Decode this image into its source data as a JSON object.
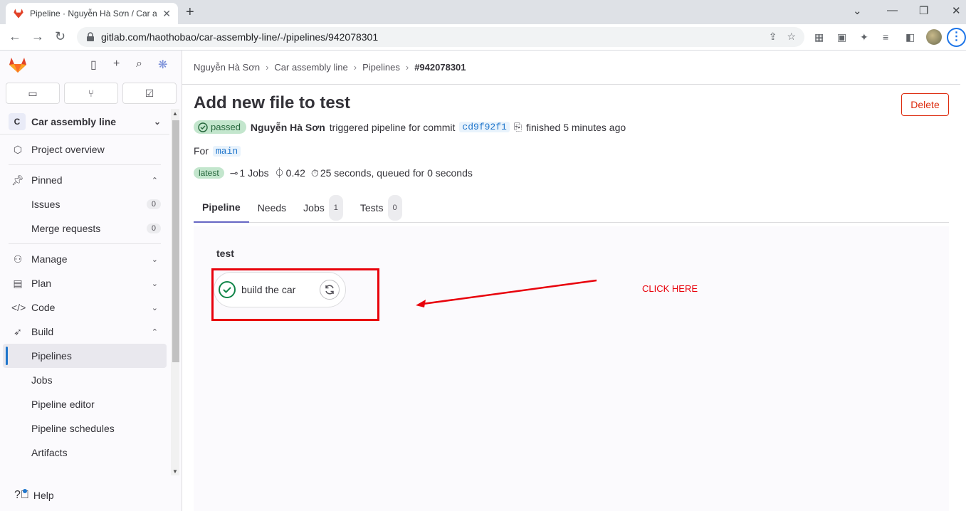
{
  "browser": {
    "tab_title": "Pipeline · Nguyễn Hà Sơn / Car a",
    "url": "gitlab.com/haothobao/car-assembly-line/-/pipelines/942078301"
  },
  "sidebar": {
    "project_initial": "C",
    "project_name": "Car assembly line",
    "items": {
      "project_overview": "Project overview",
      "pinned": "Pinned",
      "issues": "Issues",
      "issues_count": "0",
      "merge_requests": "Merge requests",
      "merge_requests_count": "0",
      "manage": "Manage",
      "plan": "Plan",
      "code": "Code",
      "build": "Build",
      "pipelines": "Pipelines",
      "jobs": "Jobs",
      "pipeline_editor": "Pipeline editor",
      "pipeline_schedules": "Pipeline schedules",
      "artifacts": "Artifacts"
    },
    "help": "Help"
  },
  "breadcrumb": [
    "Nguyễn Hà Sơn",
    "Car assembly line",
    "Pipelines",
    "#942078301"
  ],
  "pipeline": {
    "title": "Add new file to test",
    "delete_label": "Delete",
    "status": "passed",
    "author": "Nguyễn Hà Sơn",
    "triggered_text": "triggered pipeline for commit",
    "commit": "cd9f92f1",
    "finished_text": "finished 5 minutes ago",
    "for_label": "For",
    "branch": "main",
    "latest_badge": "latest",
    "jobs_count_text": "1 Jobs",
    "compute": "0.42",
    "duration_text": "25 seconds, queued for 0 seconds"
  },
  "tabs": [
    {
      "label": "Pipeline"
    },
    {
      "label": "Needs"
    },
    {
      "label": "Jobs",
      "count": "1"
    },
    {
      "label": "Tests",
      "count": "0"
    }
  ],
  "graph": {
    "stage_name": "test",
    "job_name": "build the car"
  },
  "annotation": {
    "text": "CLICK HERE",
    "color": "#e8000b"
  }
}
